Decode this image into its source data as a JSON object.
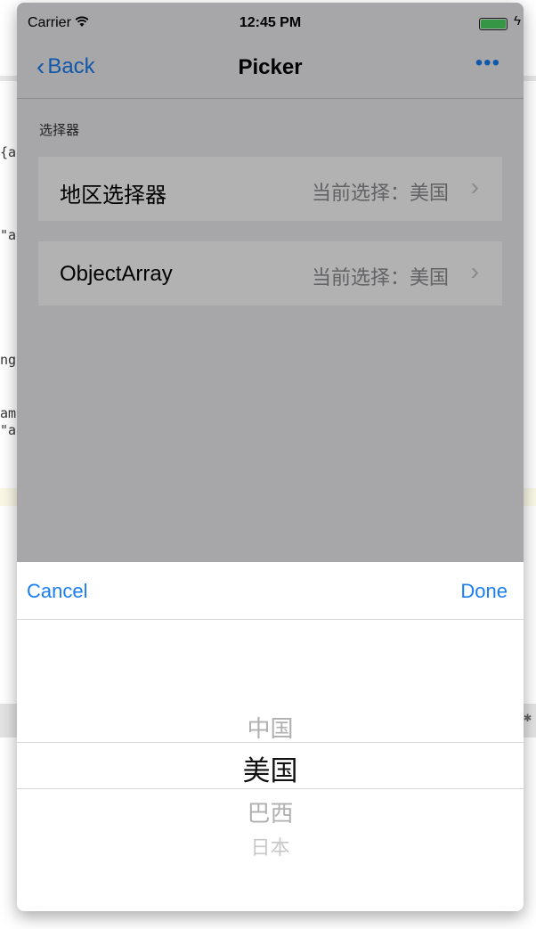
{
  "background": {
    "fragments": [
      "{a",
      "\"a",
      "ng",
      "am",
      "\"a"
    ]
  },
  "status_bar": {
    "carrier": "Carrier",
    "time": "12:45 PM"
  },
  "nav": {
    "back_label": "Back",
    "title": "Picker",
    "more_label": "•••"
  },
  "section": {
    "header": "选择器",
    "rows": [
      {
        "title": "地区选择器",
        "detail": "当前选择：美国"
      },
      {
        "title": "ObjectArray",
        "detail": "当前选择：美国"
      }
    ]
  },
  "sheet": {
    "cancel_label": "Cancel",
    "done_label": "Done",
    "options": [
      "中国",
      "美国",
      "巴西",
      "日本"
    ],
    "selected": "美国"
  },
  "colors": {
    "accent": "#1a7ef2",
    "battery": "#4cd964"
  }
}
